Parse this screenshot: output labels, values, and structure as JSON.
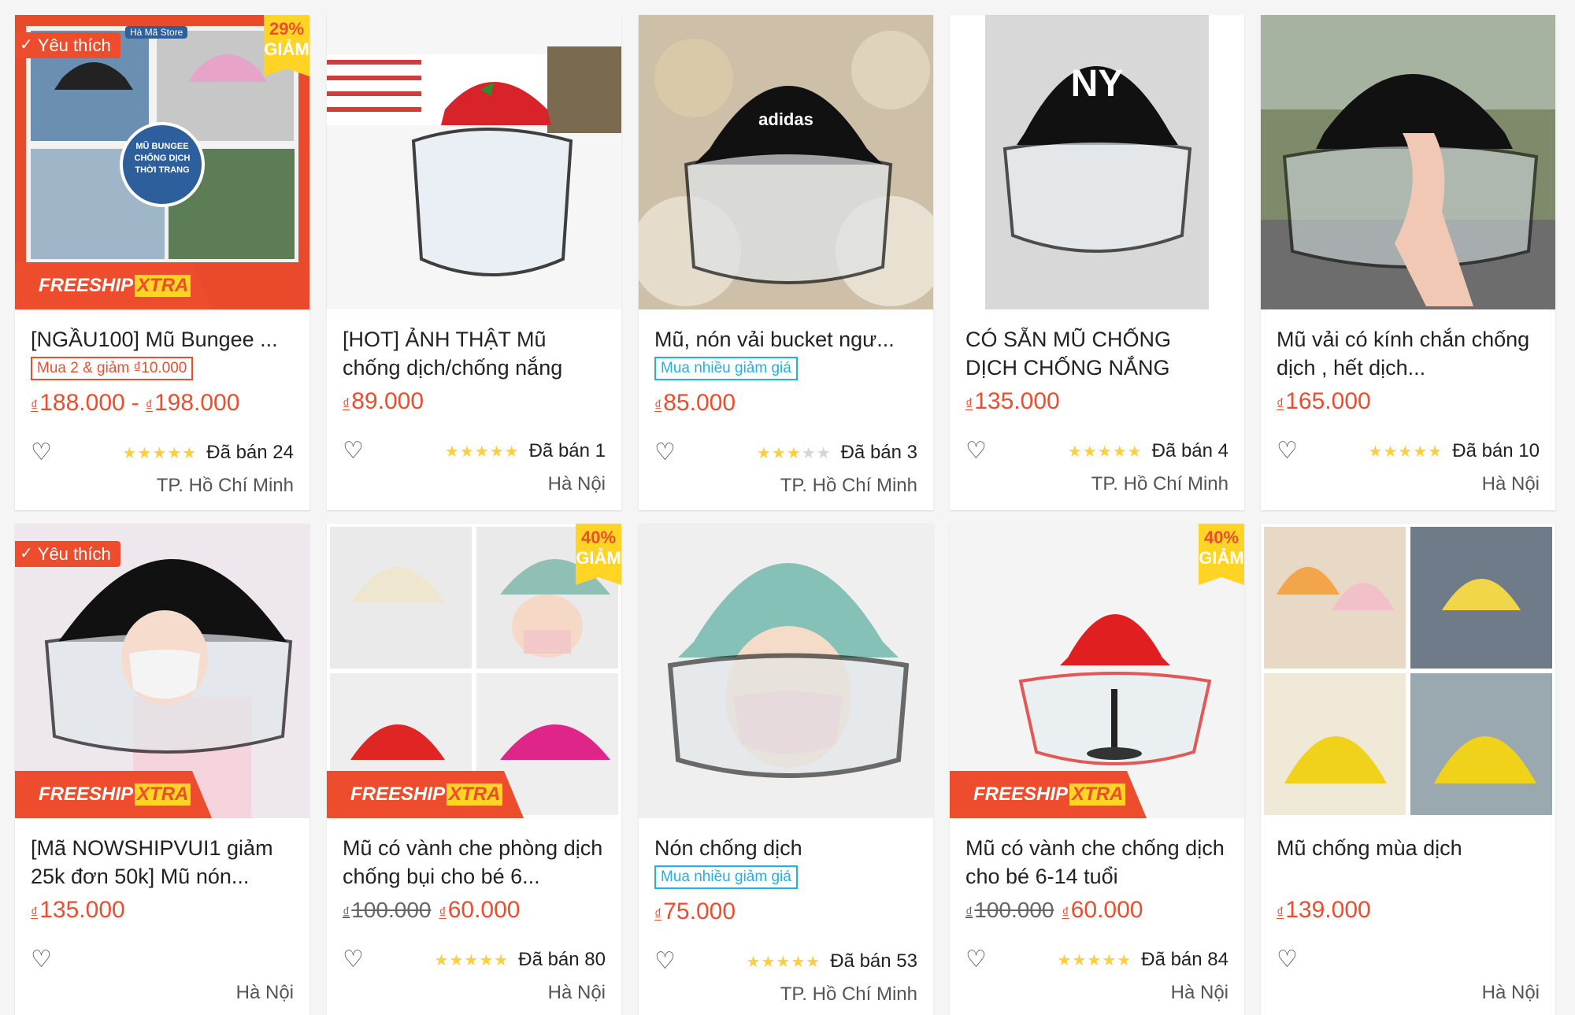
{
  "colors": {
    "accent": "#ee4d2d",
    "yellow": "#ffd424",
    "blue_tag": "#1eb0e6",
    "star": "#ffce3d"
  },
  "products": [
    {
      "favorite": "Yêu thích",
      "discount_pct": "29%",
      "discount_label": "GIẢM",
      "freeship": true,
      "title": "[NGẦU100] Mũ Bungee ...",
      "promo": "Mua 2 & giảm ₫10.000",
      "promo_style": "red",
      "price_cur": "₫",
      "price": "188.000",
      "price_sep": "-",
      "price_cur2": "₫",
      "price2": "198.000",
      "rating": 5,
      "sold": "Đã bán 24",
      "location": "TP. Hồ Chí Minh",
      "image_text": {
        "store": "Hà Mã Store",
        "badge": "MŨ BUNGEE CHỐNG DỊCH THỜI TRANG"
      }
    },
    {
      "title": "[HOT] ẢNH THẬT Mũ chống dịch/chống nắng",
      "price_cur": "₫",
      "price": "89.000",
      "rating": 5,
      "sold": "Đã bán 1",
      "location": "Hà Nội"
    },
    {
      "title": "Mũ, nón vải bucket ngư...",
      "promo": "Mua nhiều giảm giá",
      "promo_style": "blue",
      "price_cur": "₫",
      "price": "85.000",
      "rating": 3,
      "sold": "Đã bán 3",
      "location": "TP. Hồ Chí Minh",
      "image_text": {
        "brand": "adidas"
      }
    },
    {
      "title": "CÓ SẴN MŨ CHỐNG DỊCH CHỐNG NẮNG",
      "price_cur": "₫",
      "price": "135.000",
      "rating": 5,
      "sold": "Đã bán 4",
      "location": "TP. Hồ Chí Minh",
      "image_text": {
        "brand": "NY"
      }
    },
    {
      "title": "Mũ vải có kính chắn chống dịch , hết dịch...",
      "price_cur": "₫",
      "price": "165.000",
      "rating": 5,
      "sold": "Đã bán 10",
      "location": "Hà Nội"
    },
    {
      "favorite": "Yêu thích",
      "freeship": true,
      "title": "[Mã NOWSHIPVUI1 giảm 25k đơn 50k] Mũ nón...",
      "price_cur": "₫",
      "price": "135.000",
      "rating": 0,
      "sold": "",
      "location": "Hà Nội"
    },
    {
      "discount_pct": "40%",
      "discount_label": "GIẢM",
      "freeship": true,
      "title": "Mũ có vành che phòng dịch chống bụi cho bé 6...",
      "old_cur": "₫",
      "old_price": "100.000",
      "price_cur": "₫",
      "price": "60.000",
      "rating": 5,
      "sold": "Đã bán 80",
      "location": "Hà Nội"
    },
    {
      "title": "Nón chống dịch",
      "promo": "Mua nhiều giảm giá",
      "promo_style": "blue",
      "price_cur": "₫",
      "price": "75.000",
      "rating": 5,
      "sold": "Đã bán 53",
      "location": "TP. Hồ Chí Minh"
    },
    {
      "discount_pct": "40%",
      "discount_label": "GIẢM",
      "freeship": true,
      "title": "Mũ có vành che chống dịch cho bé 6-14 tuổi",
      "old_cur": "₫",
      "old_price": "100.000",
      "price_cur": "₫",
      "price": "60.000",
      "rating": 4.5,
      "sold": "Đã bán 84",
      "location": "Hà Nội"
    },
    {
      "title": "Mũ chống mùa dịch",
      "price_cur": "₫",
      "price": "139.000",
      "rating": 0,
      "sold": "",
      "location": "Hà Nội"
    }
  ],
  "freeship_text": {
    "part1": "FREESHIP",
    "part2": "XTRA"
  }
}
